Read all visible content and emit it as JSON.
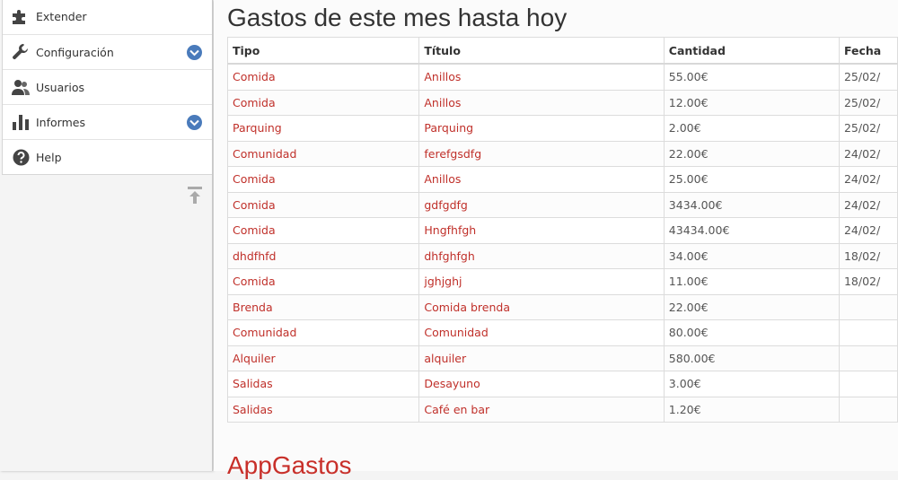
{
  "sidebar": {
    "items": [
      {
        "label": "Extender",
        "icon": "puzzle-icon",
        "expandable": false
      },
      {
        "label": "Configuración",
        "icon": "wrench-icon",
        "expandable": true
      },
      {
        "label": "Usuarios",
        "icon": "users-icon",
        "expandable": false
      },
      {
        "label": "Informes",
        "icon": "bar-chart-icon",
        "expandable": true
      },
      {
        "label": "Help",
        "icon": "help-icon",
        "expandable": false
      }
    ],
    "collapse_icon": "collapse-up-icon"
  },
  "main": {
    "title": "Gastos de este mes hasta hoy",
    "table": {
      "headers": [
        "Tipo",
        "Título",
        "Cantidad",
        "Fecha"
      ],
      "rows": [
        {
          "tipo": "Comida",
          "titulo": "Anillos",
          "cantidad": "55.00€",
          "fecha": "25/02/"
        },
        {
          "tipo": "Comida",
          "titulo": "Anillos",
          "cantidad": "12.00€",
          "fecha": "25/02/"
        },
        {
          "tipo": "Parquing",
          "titulo": "Parquing",
          "cantidad": "2.00€",
          "fecha": "25/02/"
        },
        {
          "tipo": "Comunidad",
          "titulo": "ferefgsdfg",
          "cantidad": "22.00€",
          "fecha": "24/02/"
        },
        {
          "tipo": "Comida",
          "titulo": "Anillos",
          "cantidad": "25.00€",
          "fecha": "24/02/"
        },
        {
          "tipo": "Comida",
          "titulo": "gdfgdfg",
          "cantidad": "3434.00€",
          "fecha": "24/02/"
        },
        {
          "tipo": "Comida",
          "titulo": "Hngfhfgh",
          "cantidad": "43434.00€",
          "fecha": "24/02/"
        },
        {
          "tipo": "dhdfhfd",
          "titulo": "dhfghfgh",
          "cantidad": "34.00€",
          "fecha": "18/02/"
        },
        {
          "tipo": "Comida",
          "titulo": "jghjghj",
          "cantidad": "11.00€",
          "fecha": "18/02/"
        },
        {
          "tipo": "Brenda",
          "titulo": "Comida brenda",
          "cantidad": "22.00€",
          "fecha": ""
        },
        {
          "tipo": "Comunidad",
          "titulo": "Comunidad",
          "cantidad": "80.00€",
          "fecha": ""
        },
        {
          "tipo": "Alquiler",
          "titulo": "alquiler",
          "cantidad": "580.00€",
          "fecha": ""
        },
        {
          "tipo": "Salidas",
          "titulo": "Desayuno",
          "cantidad": "3.00€",
          "fecha": ""
        },
        {
          "tipo": "Salidas",
          "titulo": "Café en bar",
          "cantidad": "1.20€",
          "fecha": ""
        }
      ]
    },
    "app_title": "AppGastos"
  },
  "colors": {
    "link": "#c0302a",
    "chevron": "#4a7bbb"
  }
}
